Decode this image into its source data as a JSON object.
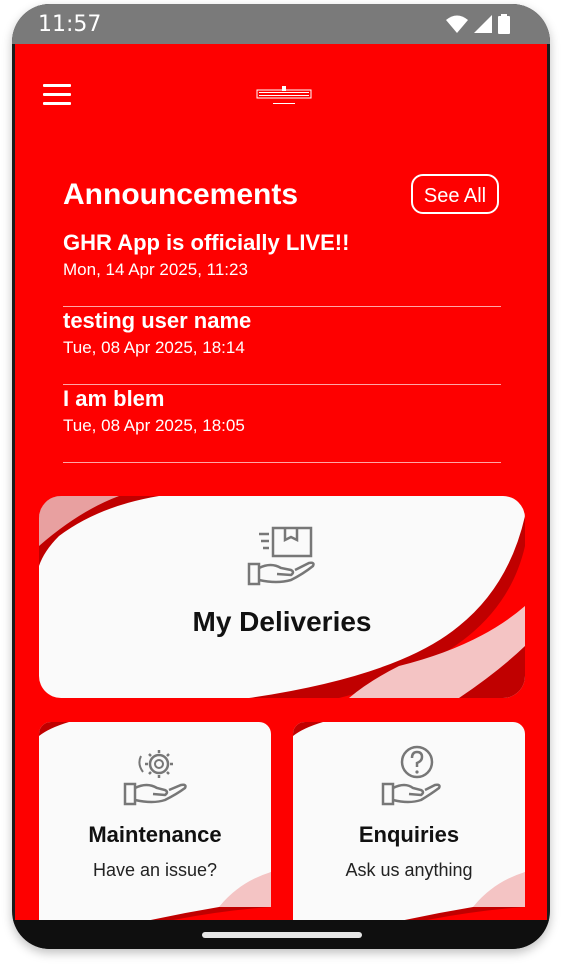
{
  "status_bar": {
    "time": "11:57",
    "icons": [
      "wifi-icon",
      "cellular-signal-icon",
      "battery-icon"
    ]
  },
  "header": {
    "menu_icon": "hamburger-menu-icon",
    "logo": "app-logo"
  },
  "announcements": {
    "title": "Announcements",
    "see_all_label": "See All",
    "items": [
      {
        "title": "GHR App is officially LIVE!!",
        "date": "Mon, 14 Apr 2025, 11:23"
      },
      {
        "title": "testing user name",
        "date": "Tue, 08 Apr 2025, 18:14"
      },
      {
        "title": "I am blem",
        "date": "Tue, 08 Apr 2025, 18:05"
      }
    ]
  },
  "cards": {
    "deliveries": {
      "title": "My Deliveries",
      "icon": "package-hand-icon"
    },
    "maintenance": {
      "title": "Maintenance",
      "subtitle": "Have an issue?",
      "icon": "gear-hand-icon"
    },
    "enquiries": {
      "title": "Enquiries",
      "subtitle": "Ask us anything",
      "icon": "question-hand-icon"
    }
  },
  "colors": {
    "primary": "#fe0000",
    "card_background": "#fafafa",
    "wave_dark": "#c00000"
  }
}
